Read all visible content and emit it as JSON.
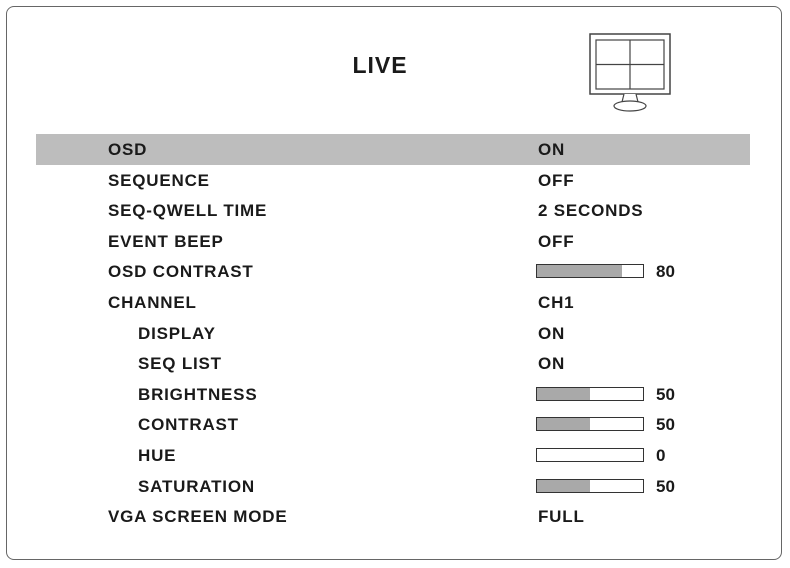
{
  "title": "LIVE",
  "icons": {
    "monitor": "quad-split-monitor-icon"
  },
  "colors": {
    "selected_row": "#bdbdbd",
    "bar_fill": "#a9a9a9"
  },
  "menu": [
    {
      "label": "OSD",
      "value": "ON",
      "selected": true
    },
    {
      "label": "SEQUENCE",
      "value": "OFF"
    },
    {
      "label": "SEQ-QWELL TIME",
      "value": "2 SECONDS"
    },
    {
      "label": "EVENT BEEP",
      "value": "OFF"
    },
    {
      "label": "OSD CONTRAST",
      "bar": 80,
      "bar_label": "80"
    },
    {
      "label": "CHANNEL",
      "value": "CH1"
    },
    {
      "label": "DISPLAY",
      "value": "ON",
      "sub": true
    },
    {
      "label": "SEQ LIST",
      "value": "ON",
      "sub": true
    },
    {
      "label": "BRIGHTNESS",
      "bar": 50,
      "bar_label": "50",
      "sub": true
    },
    {
      "label": "CONTRAST",
      "bar": 50,
      "bar_label": "50",
      "sub": true
    },
    {
      "label": "HUE",
      "bar": 0,
      "bar_label": "0",
      "sub": true
    },
    {
      "label": "SATURATION",
      "bar": 50,
      "bar_label": "50",
      "sub": true
    },
    {
      "label": "VGA SCREEN MODE",
      "value": "FULL"
    }
  ]
}
